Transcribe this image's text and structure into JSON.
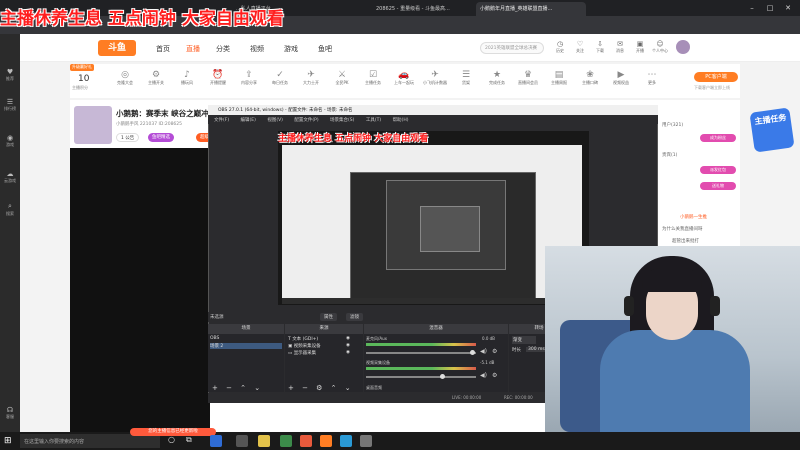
{
  "overlay": {
    "title": "主播休养生息 五点闹钟 大家自由观看"
  },
  "browser": {
    "tabs": [
      {
        "label": "...私人直播平台"
      },
      {
        "label": "208625 - 重量级看 - 斗鱼最高..."
      },
      {
        "label": "小鹅鹅年月直播_英雄联盟直播..."
      }
    ]
  },
  "douyu": {
    "logo": "斗鱼",
    "nav": [
      "首页",
      "直播",
      "分类",
      "视频",
      "游戏",
      "鱼吧"
    ],
    "nav_active_index": 1,
    "search_placeholder": "2021英雄联盟全球总决赛",
    "top_icons": [
      "历史",
      "关注",
      "下载",
      "消息",
      "开播",
      "个人中心"
    ],
    "sidebar": [
      "推荐",
      "排行榜",
      "游戏",
      "云游戏",
      "搜索",
      "客服"
    ],
    "level_badge": "升级赢好礼",
    "level_num": "10",
    "level_label": "主播积分",
    "toolbar_items": [
      "克隆大会",
      "主播开关",
      "播玩风",
      "开播提醒",
      "内容分享",
      "每日任务",
      "大力士开",
      "全民PK",
      "主播任务",
      "上车一起玩",
      "小飞机计数器",
      "货架",
      "完成任务",
      "直播间会员",
      "主播周报",
      "主播口碑",
      "视频权益",
      "更多"
    ],
    "pc_button": "PC客户端",
    "pc_sub": "下载客户端立即上线",
    "room": {
      "title": "小鹅鹅：赛季末 峡谷之巅冲",
      "meta": "小鹅鹅手风  221037  ID:208625",
      "buttons": [
        "鱼吧精选",
        "超级粉丝团",
        "直播设置"
      ],
      "follow_count": "1  公告"
    },
    "chat": {
      "lines": [
        "用户(321)",
        "贵宾(1)",
        "小鹅鹅一生推",
        "为什么关我直播间呀",
        "超管出来批打"
      ],
      "buttons": [
        "成为粉丝",
        "派发红包",
        "送礼物"
      ]
    },
    "mascot": "主播任务"
  },
  "obs": {
    "title": "OBS 27.0.1 (64-bit, windows) - 配置文件: 未命名 - 场景: 未命名",
    "menu": [
      "文件(F)",
      "编辑(E)",
      "视图(V)",
      "配置文件(P)",
      "场景集合(S)",
      "工具(T)",
      "帮助(H)"
    ],
    "controls": [
      "未选源",
      "属性",
      "滤镜"
    ],
    "docks": [
      "场景",
      "来源",
      "混音器",
      "转场"
    ],
    "scenes": [
      "OBS",
      "场景 2"
    ],
    "sources": [
      "文本 (GDI+)",
      "视频采集设备",
      "显示器采集"
    ],
    "mixer": [
      {
        "name": "麦克风/Aux",
        "db": "0.0 dB"
      },
      {
        "name": "视频采集设备",
        "db": "-5.1 dB"
      },
      {
        "name": "桌面音频",
        "db": ""
      }
    ],
    "transition": {
      "label": "渐变",
      "duration_label": "时长",
      "duration": "300 ms"
    },
    "status": {
      "live": "LIVE: 00:00:00",
      "rec": "REC: 00:00:00",
      "cpu": "CPU: 3.0%, 30.00 fps"
    }
  },
  "taskbar": {
    "search_placeholder": "在这里输入你要搜索的内容",
    "notice": "您的主播信息已经更新啦"
  }
}
